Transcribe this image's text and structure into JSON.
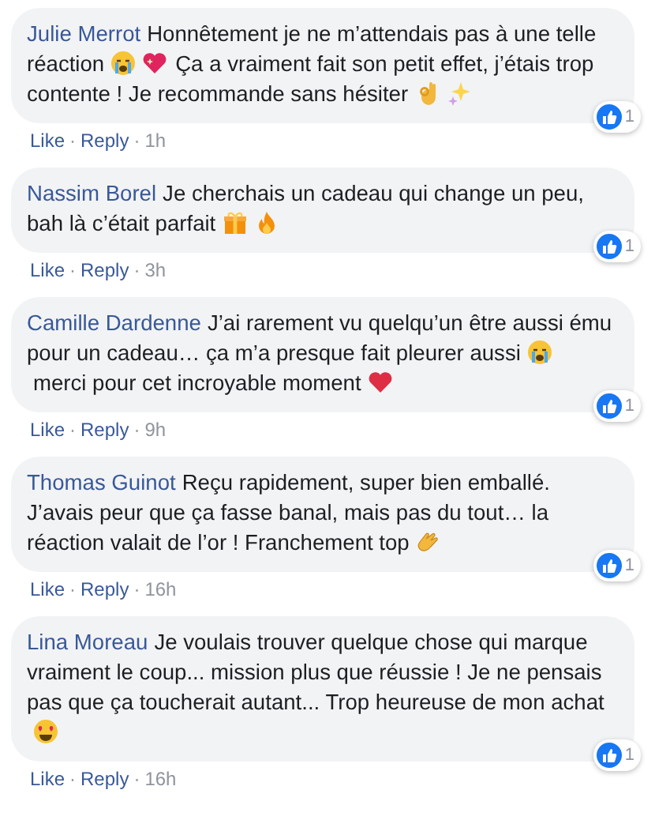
{
  "comments": [
    {
      "author": "Julie Merrot",
      "body": [
        {
          "kind": "text",
          "text": "Honnêtement je ne m’attendais pas à une telle réaction"
        },
        {
          "kind": "crying"
        },
        {
          "kind": "sparkling-heart"
        },
        {
          "kind": "text",
          "text": "Ça a vraiment fait son petit effet, j’étais trop contente ! Je recommande sans hésiter"
        },
        {
          "kind": "ok-hand"
        },
        {
          "kind": "sparkles"
        }
      ],
      "likes": "1",
      "footer": [
        {
          "kind": "link",
          "text": "Like"
        },
        {
          "kind": "dot",
          "text": "·"
        },
        {
          "kind": "link",
          "text": "Reply"
        },
        {
          "kind": "dot",
          "text": "·"
        },
        {
          "kind": "time",
          "text": "1h"
        }
      ]
    },
    {
      "author": "Nassim Borel",
      "body": [
        {
          "kind": "text",
          "text": "Je cherchais un cadeau qui change un peu, bah là c’était parfait"
        },
        {
          "kind": "gift"
        },
        {
          "kind": "fire"
        }
      ],
      "likes": "1",
      "footer": [
        {
          "kind": "link",
          "text": "Like"
        },
        {
          "kind": "dot",
          "text": "·"
        },
        {
          "kind": "link",
          "text": "Reply"
        },
        {
          "kind": "dot",
          "text": "·"
        },
        {
          "kind": "time",
          "text": "3h"
        }
      ]
    },
    {
      "author": "Camille Dardenne",
      "body": [
        {
          "kind": "text",
          "text": "J’ai rarement vu quelqu’un être aussi ému pour un cadeau… ça m’a presque fait pleurer aussi"
        },
        {
          "kind": "crying"
        },
        {
          "kind": "text",
          "text": "merci pour cet incroyable moment"
        },
        {
          "kind": "heart"
        }
      ],
      "likes": "1",
      "footer": [
        {
          "kind": "link",
          "text": "Like"
        },
        {
          "kind": "dot",
          "text": "·"
        },
        {
          "kind": "link",
          "text": "Reply"
        },
        {
          "kind": "dot",
          "text": "·"
        },
        {
          "kind": "time",
          "text": "9h"
        }
      ]
    },
    {
      "author": "Thomas Guinot",
      "body": [
        {
          "kind": "text",
          "text": "Reçu rapidement, super bien emballé. J’avais peur que ça fasse banal, mais pas du tout… la réaction valait de l’or ! Franchement top"
        },
        {
          "kind": "clap"
        }
      ],
      "likes": "1",
      "footer": [
        {
          "kind": "link",
          "text": "Like"
        },
        {
          "kind": "dot",
          "text": "·"
        },
        {
          "kind": "link",
          "text": "Reply"
        },
        {
          "kind": "dot",
          "text": "·"
        },
        {
          "kind": "time",
          "text": "16h"
        }
      ]
    },
    {
      "author": "Lina Moreau",
      "body": [
        {
          "kind": "text",
          "text": "Je voulais trouver quelque chose qui marque vraiment le coup... mission plus que réussie ! Je ne pensais pas que ça toucherait autant... Trop heureuse de mon achat"
        },
        {
          "kind": "heart-eyes"
        }
      ],
      "likes": "1",
      "footer": [
        {
          "kind": "link",
          "text": "Like"
        },
        {
          "kind": "dot",
          "text": "·"
        },
        {
          "kind": "link",
          "text": "Reply"
        },
        {
          "kind": "dot",
          "text": "·"
        },
        {
          "kind": "time",
          "text": "16h"
        }
      ]
    }
  ]
}
